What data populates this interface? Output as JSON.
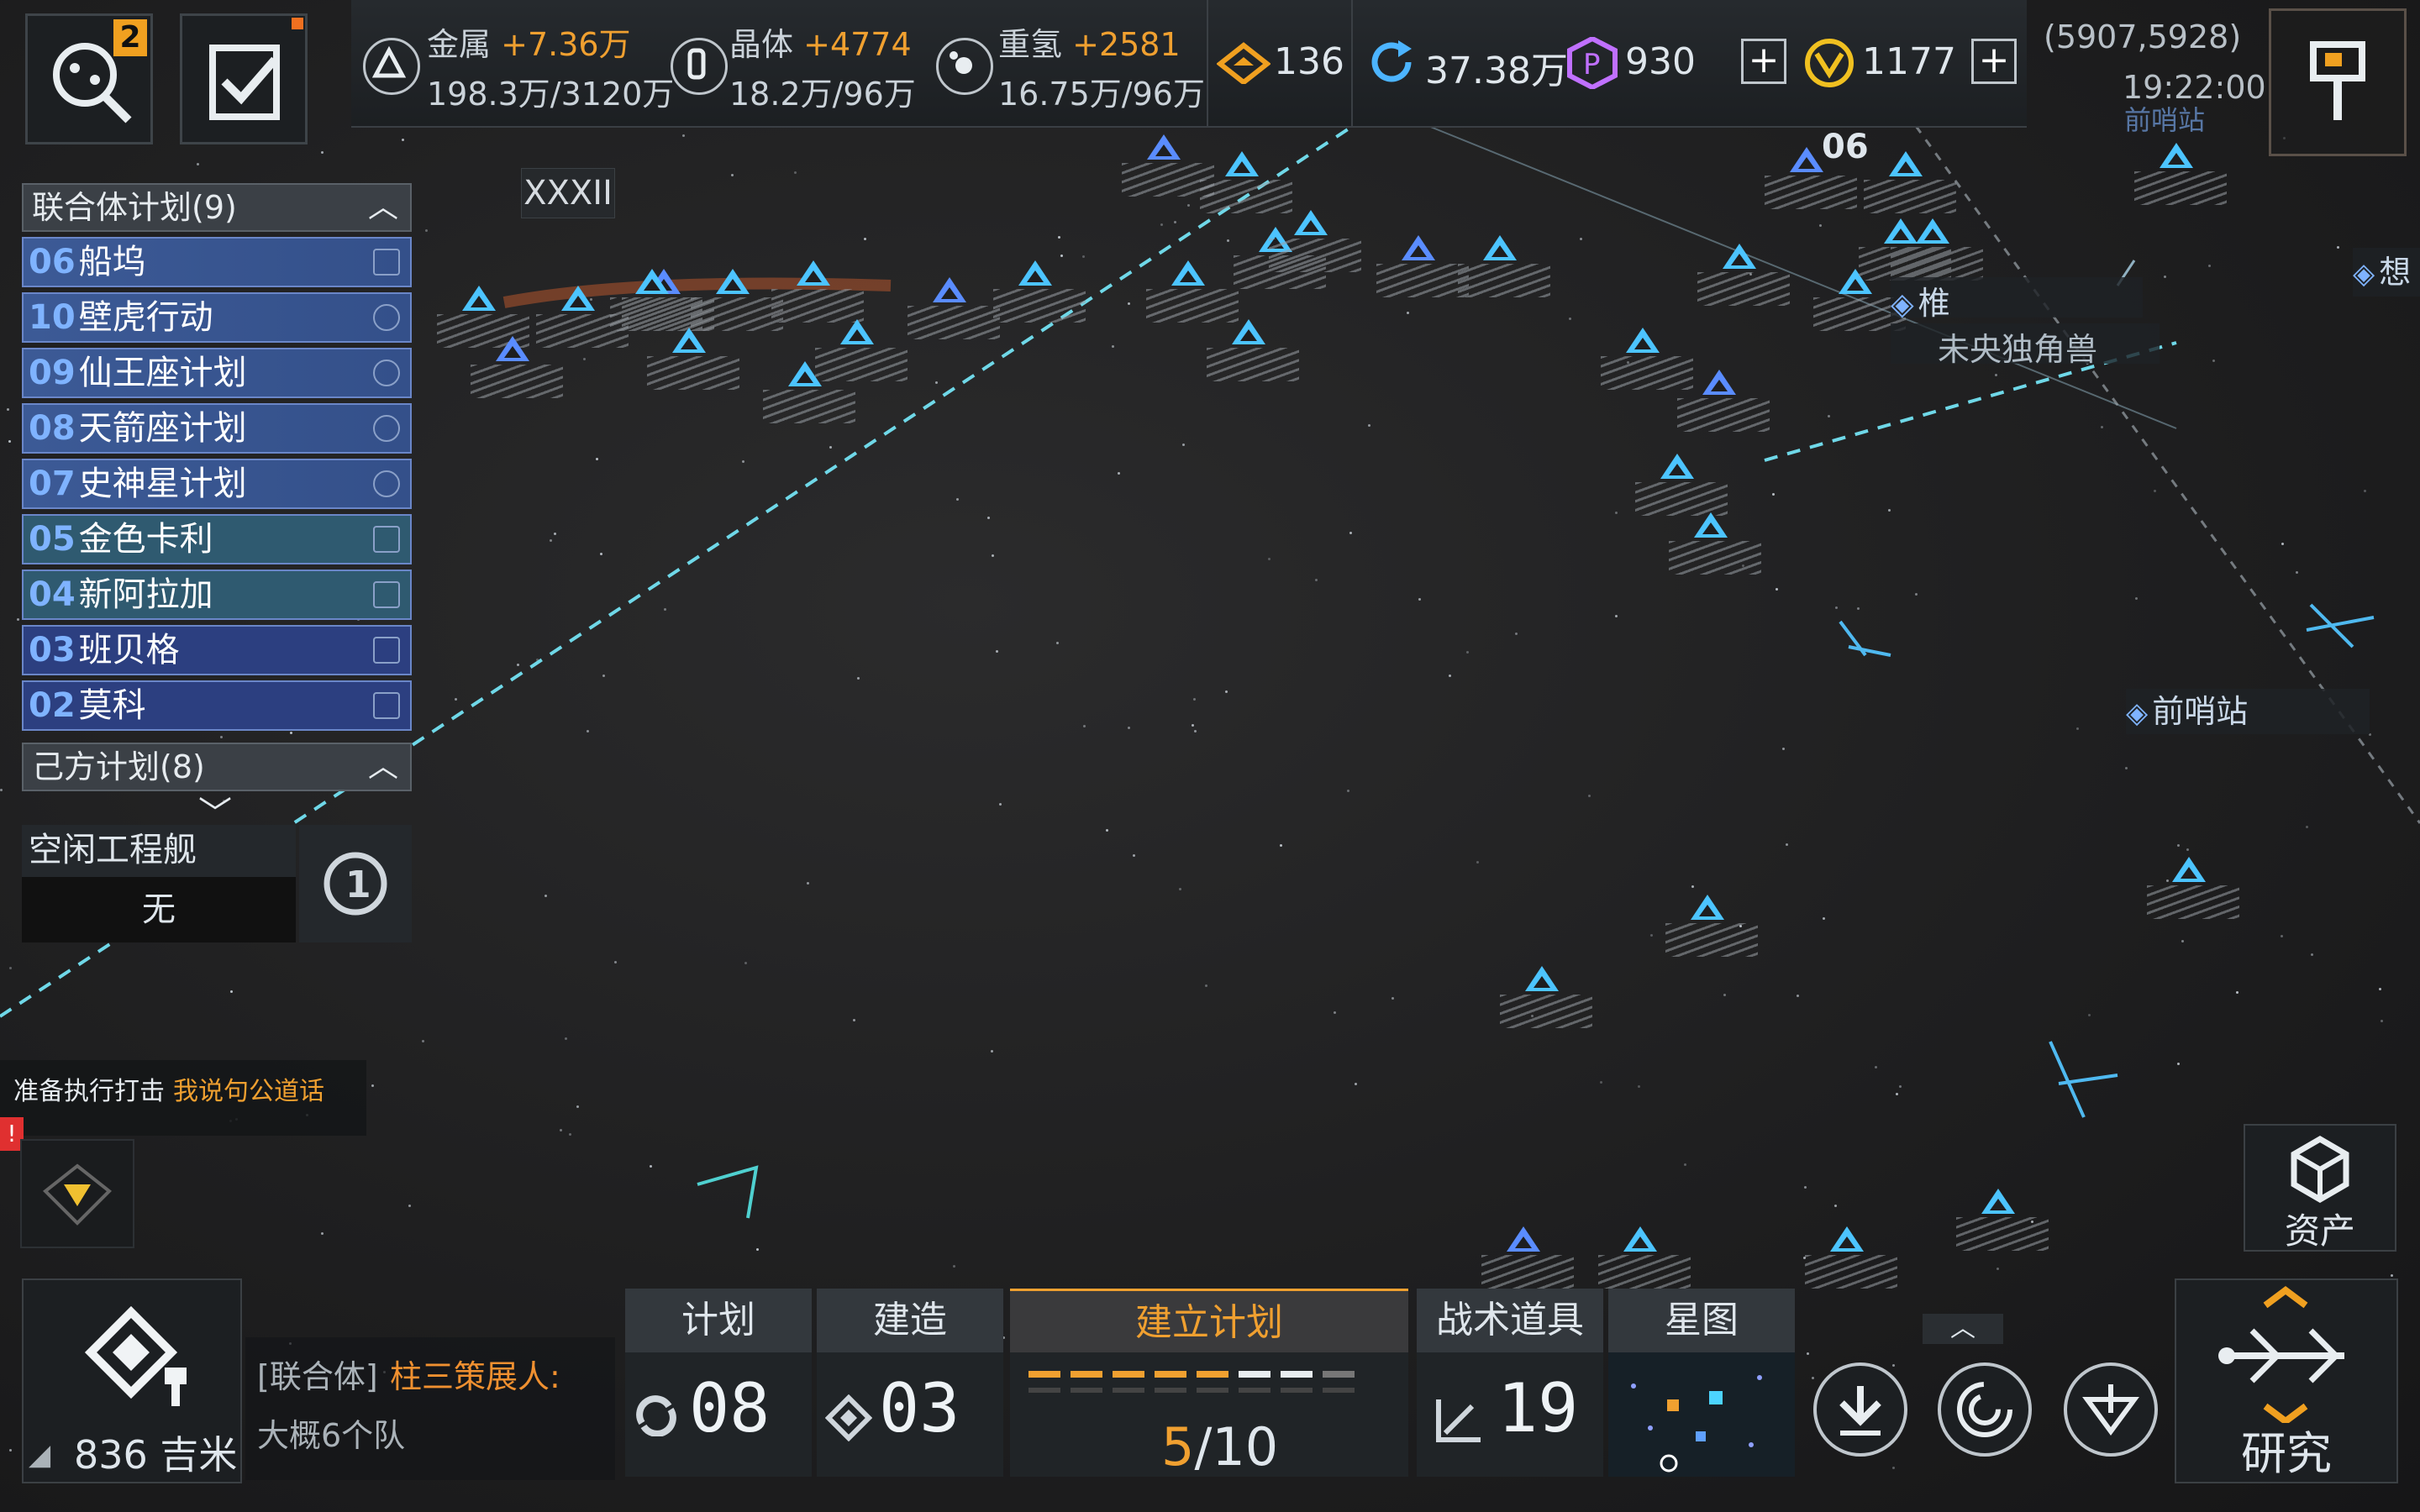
{
  "top_left": {
    "search_badge": "2"
  },
  "resources": [
    {
      "name": "金属",
      "delta": "+7.36万",
      "amount": "198.3万/3120万"
    },
    {
      "name": "晶体",
      "delta": "+4774",
      "amount": "18.2万/96万"
    },
    {
      "name": "重氢",
      "delta": "+2581",
      "amount": "16.75万/96万"
    }
  ],
  "currencies": {
    "c1": "136",
    "c2": "37.38万",
    "c3": "930",
    "c4": "1177"
  },
  "coords": {
    "position": "(5907,5928)",
    "time": "19:22:00"
  },
  "union_plans": {
    "title": "联合体计划(9)",
    "items": [
      {
        "num": "06",
        "label": "船坞"
      },
      {
        "num": "10",
        "label": "壁虎行动"
      },
      {
        "num": "09",
        "label": "仙王座计划"
      },
      {
        "num": "08",
        "label": "天箭座计划"
      },
      {
        "num": "07",
        "label": "史神星计划"
      },
      {
        "num": "05",
        "label": "金色卡利"
      },
      {
        "num": "04",
        "label": "新阿拉加"
      },
      {
        "num": "03",
        "label": "班贝格"
      },
      {
        "num": "02",
        "label": "莫科"
      }
    ]
  },
  "own_plans": {
    "title": "己方计划(8)"
  },
  "idle_ships": {
    "label": "空闲工程舰",
    "value": "无"
  },
  "map_labels": {
    "sector": "XXXII",
    "zone": "06",
    "base1": "椎",
    "base2": "未央独角兽",
    "outpost": "前哨站",
    "outpost_top": "前哨站",
    "edge": "想"
  },
  "alert": {
    "prefix": "准备执行打击",
    "name": "我说句公道话"
  },
  "distance": "836 吉米",
  "chat": {
    "channel": "[联合体]",
    "sender": "柱三策展人:",
    "message": "大概6个队"
  },
  "tabs": {
    "plan": "计划",
    "build": "建造",
    "create": "建立计划",
    "tactics": "战术道具",
    "starmap": "星图"
  },
  "counts": {
    "plan": "08",
    "build": "03",
    "progress_cur": "5",
    "progress_total": "/10",
    "tactics": "19"
  },
  "assets": "资产",
  "research": "研究"
}
